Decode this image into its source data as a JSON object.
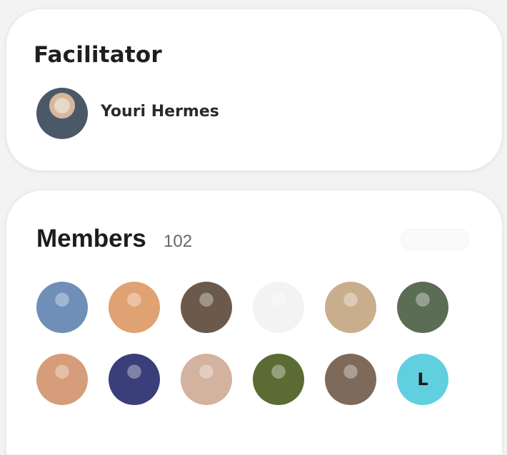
{
  "facilitator_card": {
    "title": "Facilitator",
    "facilitator": {
      "name": "Youri Hermes"
    }
  },
  "members_card": {
    "title": "Members",
    "count": "102",
    "members": [
      {
        "initial": "",
        "color": "#6f8fb8"
      },
      {
        "initial": "",
        "color": "#e0a273"
      },
      {
        "initial": "",
        "color": "#6b5a4b"
      },
      {
        "initial": "",
        "color": "#f3f3f3"
      },
      {
        "initial": "",
        "color": "#c9ae8e"
      },
      {
        "initial": "",
        "color": "#5c6d55"
      },
      {
        "initial": "",
        "color": "#d59d79"
      },
      {
        "initial": "",
        "color": "#3a3f7a"
      },
      {
        "initial": "",
        "color": "#d3b29f"
      },
      {
        "initial": "",
        "color": "#5a6b34"
      },
      {
        "initial": "",
        "color": "#7d6a5a"
      },
      {
        "initial": "L",
        "color": "#60cfe0"
      }
    ]
  }
}
